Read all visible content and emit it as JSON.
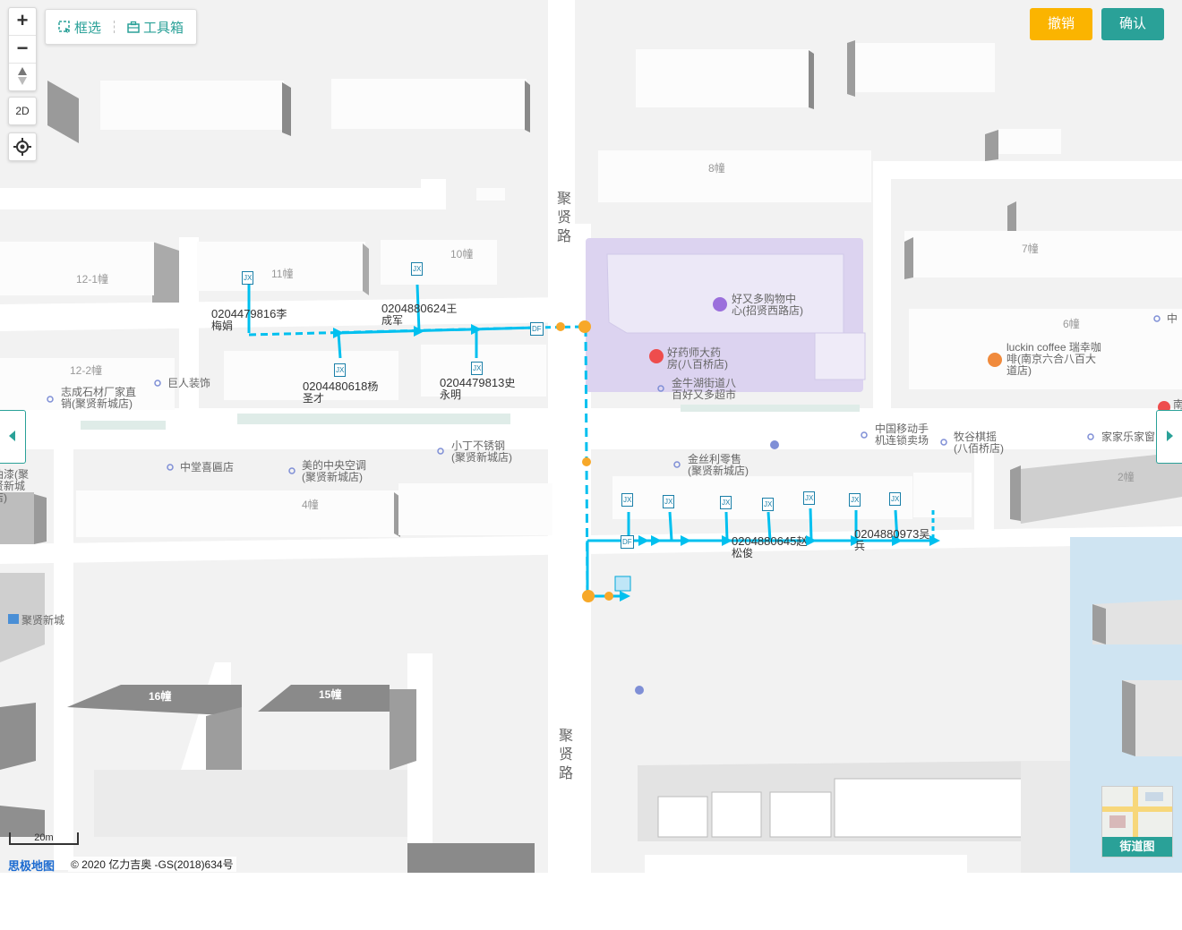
{
  "controls": {
    "zoom_in": "+",
    "zoom_out": "−",
    "compass": "▲▼",
    "view_mode": "2D",
    "locate_icon": "crosshair-icon"
  },
  "toolbar": {
    "box_select_label": "框选",
    "toolbox_label": "工具箱"
  },
  "actions": {
    "cancel_label": "撤销",
    "confirm_label": "确认",
    "cancel_color": "#fbb400",
    "confirm_color": "#2aa198"
  },
  "streetview": {
    "label": "街道图"
  },
  "scale": {
    "label": "20m"
  },
  "attribution": {
    "logo": "思极地图",
    "copyright": "© 2020 亿力吉奥 -GS(2018)634号"
  },
  "roads": {
    "main_north": "聚贤路",
    "main_south": "聚贤路"
  },
  "buildings": [
    "12-1幢",
    "11幢",
    "10幢",
    "12-2幢",
    "8幢",
    "7幢",
    "6幢",
    "4幢",
    "2幢",
    "16幢",
    "15幢"
  ],
  "pois": [
    {
      "name": "志成石材厂家直销(聚贤新城店)"
    },
    {
      "name": "巨人装饰"
    },
    {
      "name": "好又多购物中心(招贤西路店)"
    },
    {
      "name": "好药师大药房(八百桥店)"
    },
    {
      "name": "金牛湖街道八百好又多超市"
    },
    {
      "name": "luckin coffee 瑞幸咖啡(南京六合八百大道店)"
    },
    {
      "name": "中国移动手机连锁卖场"
    },
    {
      "name": "牧谷棋摇(八佰桥店)"
    },
    {
      "name": "家家乐家窗"
    },
    {
      "name": "小丁不锈钢(聚贤新城店)"
    },
    {
      "name": "中堂喜匾店"
    },
    {
      "name": "美的中央空调(聚贤新城店)"
    },
    {
      "name": "金丝利零售(聚贤新城店)"
    },
    {
      "name": "聚贤新城"
    },
    {
      "name": "油漆(聚贤新城店)"
    },
    {
      "name": "中"
    },
    {
      "name": "南"
    }
  ],
  "meters": [
    {
      "id": "0204479816",
      "owner": "李梅娟"
    },
    {
      "id": "0204880624",
      "owner": "王成军"
    },
    {
      "id": "0204480618",
      "owner": "杨圣才"
    },
    {
      "id": "0204479813",
      "owner": "史永明"
    },
    {
      "id": "0204880645",
      "owner": "赵松俊"
    },
    {
      "id": "0204880973",
      "owner": "吴兵"
    }
  ],
  "symbols": {
    "box": "JX",
    "dist": "DF"
  },
  "colors": {
    "line": "#00c0ef",
    "node": "#f7a829",
    "accent": "#2aa198",
    "mall": "#dcd3f0"
  }
}
